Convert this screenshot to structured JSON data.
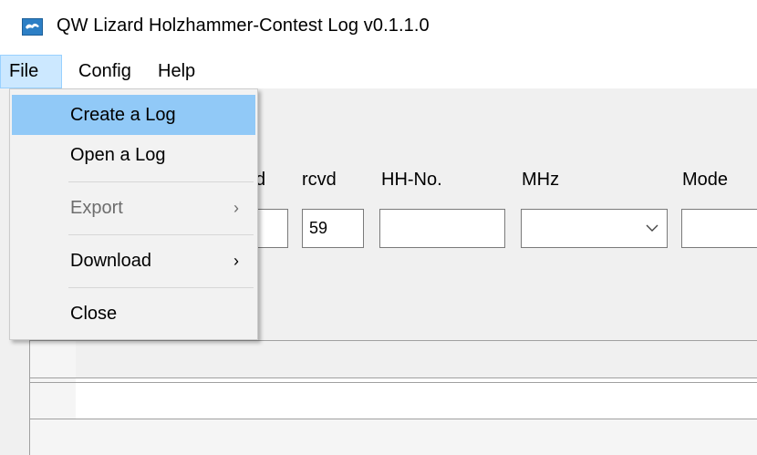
{
  "window": {
    "title": "QW Lizard Holzhammer-Contest Log v0.1.1.0",
    "icon": "lizard-app-icon"
  },
  "menubar": {
    "items": [
      {
        "label": "File",
        "active": true
      },
      {
        "label": "Config"
      },
      {
        "label": "Help"
      }
    ]
  },
  "file_menu": {
    "items": [
      {
        "label": "Create a Log",
        "highlighted": true
      },
      {
        "label": "Open a Log"
      },
      {
        "label": "Export",
        "disabled": true,
        "submenu_arrow": "›"
      },
      {
        "label": "Download",
        "submenu_arrow": "›"
      },
      {
        "label": "Close"
      }
    ]
  },
  "form": {
    "sent_label_partial": "d",
    "rcvd_label": "rcvd",
    "rcvd_value": "59",
    "hh_no_label": "HH-No.",
    "mhz_label": "MHz",
    "mode_label": "Mode"
  },
  "colors": {
    "menu_highlight": "#91c9f7",
    "menubar_active": "#cce8ff",
    "app_icon": "#2c7fc5"
  }
}
